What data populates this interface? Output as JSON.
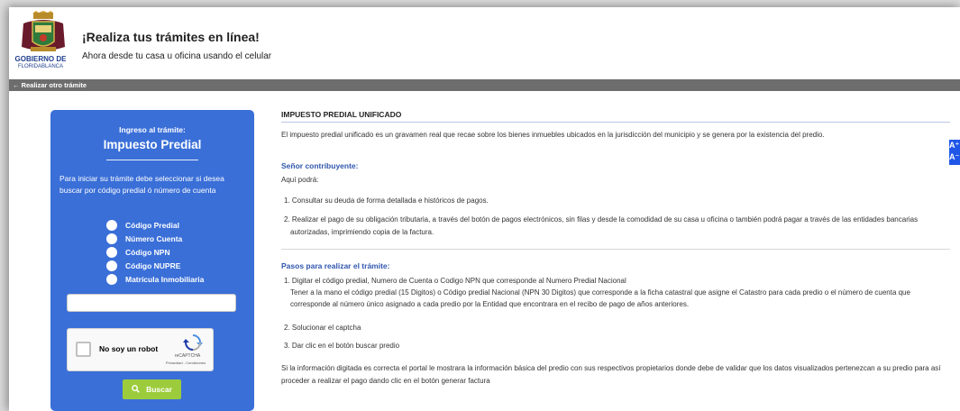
{
  "header": {
    "logo_line1": "GOBIERNO DE",
    "logo_line2": "FLORIDABLANCA",
    "title": "¡Realiza tus trámites en línea!",
    "subtitle": "Ahora desde tu casa u oficina usando el celular"
  },
  "navbar": {
    "back_label": "← Realizar otro trámite"
  },
  "card": {
    "kicker": "Ingreso al trámite:",
    "title": "Impuesto Predial",
    "description": "Para iniciar su trámite debe seleccionar si desea buscar por código predial ó número de cuenta",
    "options": [
      "Código Predial",
      "Número Cuenta",
      "Código NPN",
      "Código NUPRE",
      "Matrícula Inmobiliaria"
    ],
    "captcha_label": "No soy un robot",
    "captcha_brand": "reCAPTCHA",
    "captcha_links": "Privacidad - Condiciones",
    "search_button": "Buscar",
    "colors": {
      "card": "#3a6fd8",
      "button": "#9ccc3c"
    }
  },
  "content": {
    "section_title": "IMPUESTO PREDIAL UNIFICADO",
    "intro": "El impuesto predial unificado es un gravamen real que recae sobre los bienes inmuebles ubicados en la jurisdicción del municipio y se genera por la existencia del predio.",
    "contrib_heading": "Señor contribuyente:",
    "aqui": "Aquí podrá:",
    "item1": "1. Consultar su deuda de forma detallada e históricos de pagos.",
    "item2a": "2. Realizar el pago de su obligación tributaria, a través del botón de pagos electrónicos, sin filas y desde la comodidad de su casa u oficina o también podrá pagar a través de las entidades bancarias",
    "item2b": "autorizadas, imprimiendo copia de la factura.",
    "steps_heading": "Pasos para realizar el trámite:",
    "step1a": "1. Digitar el código predial, Numero de Cuenta o Codigo NPN que corresponde al Numero Predial Nacional",
    "step1b": "Tener a la mano el código predial (15 Digitos) o Código predial Nacional (NPN 30 Digitos) que corresponde a la ficha catastral que asigne el Catastro para cada predio o el número de cuenta que",
    "step1c": "corresponde al número único asignado a cada predio por la Entidad que encontrara en el recibo de pago de años anteriores.",
    "step2": "2. Solucionar el captcha",
    "step3": "3. Dar clic en el botón buscar predio",
    "closing_a": "Si la información digitada es correcta el portal le mostrara la información básica del predio con sus respectivos propietarios donde debe de validar que los datos visualizados pertenezcan a su predio para así",
    "closing_b": "proceder a realizar el pago dando clic en el botón generar factura"
  },
  "accessibility": {
    "increase": "A⁺",
    "decrease": "A⁻",
    "color": "#1f56e8"
  },
  "icons": {
    "logo": "coat-of-arms-icon",
    "search": "search-icon",
    "recaptcha": "recaptcha-icon"
  }
}
